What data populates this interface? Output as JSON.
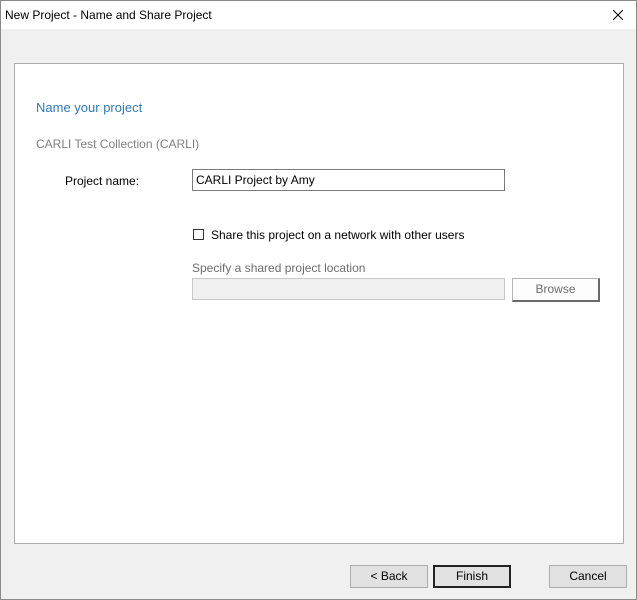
{
  "window": {
    "title": "New Project - Name and Share Project",
    "close_glyph": "✕"
  },
  "panel": {
    "heading": "Name your project",
    "collection": "CARLI Test Collection (CARLI)",
    "project_name_label": "Project name:",
    "project_name_value": "CARLI Project by Amy",
    "share_label": "Share this project on a network with other users",
    "share_checked": false,
    "location_label": "Specify a shared project location",
    "location_value": "",
    "browse_label": "Browse"
  },
  "footer": {
    "back_label": "< Back",
    "finish_label": "Finish",
    "cancel_label": "Cancel"
  },
  "colors": {
    "heading": "#2f7bbf",
    "window_bg": "#f0f0f0",
    "panel_bg": "#ffffff"
  },
  "icons": {
    "close": "close-icon",
    "checkbox": "checkbox-unchecked-icon"
  }
}
